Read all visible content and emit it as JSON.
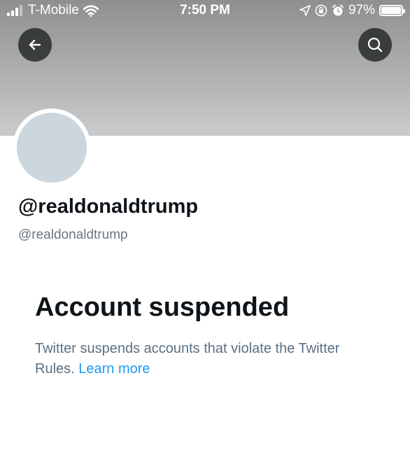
{
  "status_bar": {
    "carrier": "T-Mobile",
    "time": "7:50 PM",
    "battery": "97%",
    "icons": [
      "signal-icon",
      "wifi-icon",
      "location-arrow-icon",
      "rotation-lock-icon",
      "alarm-icon",
      "battery-icon"
    ]
  },
  "header": {
    "back_icon": "arrow-left-icon",
    "search_icon": "search-icon"
  },
  "profile": {
    "display_name": "@realdonaldtrump",
    "handle": "@realdonaldtrump"
  },
  "suspension": {
    "title": "Account suspended",
    "description": "Twitter suspends accounts that violate the Twitter Rules.",
    "link_label": "Learn more"
  },
  "colors": {
    "link": "#1d9bf0",
    "text_primary": "#0f1419",
    "text_secondary": "#5b7083",
    "avatar_placeholder": "#ccd6dd"
  }
}
